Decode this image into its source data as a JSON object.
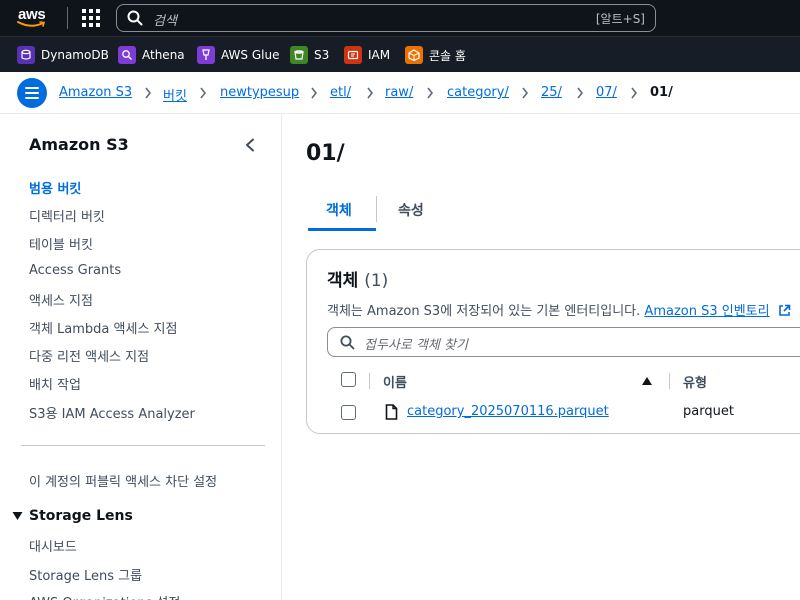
{
  "topnav": {
    "logo_text": "aws",
    "search_placeholder": "검색",
    "search_shortcut": "[알트+S]"
  },
  "favorites": [
    {
      "label": "DynamoDB",
      "icon": "dynamodb-icon",
      "color": "#5a30b5"
    },
    {
      "label": "Athena",
      "icon": "athena-icon",
      "color": "#7d3cd6"
    },
    {
      "label": "AWS Glue",
      "icon": "glue-icon",
      "color": "#7d3cd6"
    },
    {
      "label": "S3",
      "icon": "s3-icon",
      "color": "#3f8624"
    },
    {
      "label": "IAM",
      "icon": "iam-icon",
      "color": "#d13212"
    },
    {
      "label": "콘솔 홈",
      "icon": "console-home-icon",
      "color": "#ed7100"
    }
  ],
  "breadcrumb": [
    "Amazon S3",
    "버킷",
    "newtypesup",
    "etl/",
    "raw/",
    "category/",
    "25/",
    "07/",
    "01/"
  ],
  "sidebar": {
    "title": "Amazon S3",
    "items": [
      "범용 버킷",
      "디렉터리 버킷",
      "테이블 버킷",
      "Access Grants",
      "액세스 지점",
      "객체 Lambda 액세스 지점",
      "다중 리전 액세스 지점",
      "배치 작업",
      "S3용 IAM Access Analyzer"
    ],
    "active_item": "범용 버킷",
    "public_access": "이 계정의 퍼블릭 액세스 차단 설정",
    "section_title": "Storage Lens",
    "section_items": [
      "대시보드",
      "Storage Lens 그룹",
      "AWS Organizations 설정"
    ]
  },
  "main": {
    "title": "01/",
    "tabs": [
      {
        "label": "객체",
        "active": true
      },
      {
        "label": "속성",
        "active": false
      }
    ],
    "objects": {
      "title": "객체",
      "count": "(1)",
      "desc_prefix": "객체는 Amazon S3에 저장되어 있는 기본 엔터티입니다.",
      "desc_link": "Amazon S3 인벤토리",
      "filter_placeholder": "접두사로 객체 찾기",
      "columns": [
        "이름",
        "유형"
      ],
      "rows": [
        {
          "name": "category_2025070116.parquet",
          "type": "parquet",
          "icon": "file-icon"
        }
      ]
    }
  },
  "colors": {
    "nav_bg": "#0f141a",
    "fav_bg": "#161d26",
    "link": "#006ce0",
    "text": "#0f141a"
  }
}
